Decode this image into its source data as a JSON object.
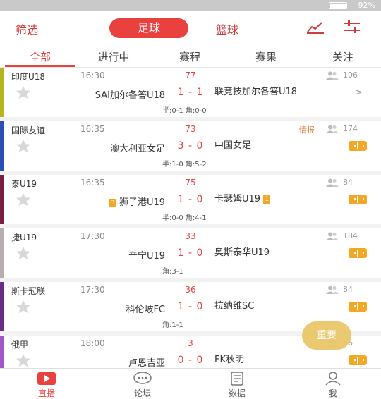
{
  "status_bar": {
    "battery": "92%"
  },
  "header": {
    "filter_label": "筛选",
    "football_label": "足球",
    "basketball_label": "篮球"
  },
  "tabs": [
    {
      "label": "全部",
      "active": true
    },
    {
      "label": "进行中"
    },
    {
      "label": "赛程"
    },
    {
      "label": "赛果"
    },
    {
      "label": "关注"
    }
  ],
  "matches": [
    {
      "league": "印度U18",
      "color": "#b5b51f",
      "time": "16:30",
      "minute": "77",
      "intel": "",
      "fans": "106",
      "home": "SAI加尔各答U18",
      "score": "1 - 1",
      "away": "联竞技加尔各答U18",
      "sub": "半:0-1   角:0-0",
      "action": "chevron"
    },
    {
      "league": "国际友谊",
      "color": "#2b4fb5",
      "time": "16:35",
      "minute": "73",
      "intel": "情报",
      "fans": "174",
      "home": "澳大利亚女足",
      "score": "3 - 0",
      "away": "中国女足",
      "sub": "半:1-0   角:5-2",
      "action": "live"
    },
    {
      "league": "泰U19",
      "color": "#7b1f3e",
      "time": "16:35",
      "minute": "75",
      "intel": "",
      "fans": "84",
      "home_rank": "3",
      "home": "狮子港U19",
      "score": "1 - 0",
      "away": "卡瑟姆U19",
      "away_rank": "1",
      "sub": "半:0-0   角:4-1",
      "action": "live"
    },
    {
      "league": "捷U19",
      "color": "#b8aeb0",
      "time": "17:30",
      "minute": "33",
      "intel": "",
      "fans": "184",
      "home": "辛宁U19",
      "score": "1 - 0",
      "away": "奥斯泰华U19",
      "sub": "角:3-1",
      "action": "live"
    },
    {
      "league": "斯卡冠联",
      "color": "#6a2d86",
      "time": "17:30",
      "minute": "36",
      "intel": "",
      "fans": "84",
      "home": "科伦坡FC",
      "score": "1 - 0",
      "away": "拉纳维SC",
      "sub": "角:1-1",
      "action": "live"
    },
    {
      "league": "俄甲",
      "color": "#a058c8",
      "time": "18:00",
      "minute": "3",
      "intel": "",
      "fans": "56",
      "home": "卢恩吉亚",
      "score": "0 - 0",
      "away": "FK秋明",
      "sub": "",
      "action": "live"
    }
  ],
  "fab_label": "重要",
  "bottom_nav": [
    {
      "label": "直播",
      "icon": "play-icon",
      "active": true
    },
    {
      "label": "论坛",
      "icon": "chat-bubble-icon"
    },
    {
      "label": "数据",
      "icon": "document-icon"
    },
    {
      "label": "我",
      "icon": "person-icon"
    }
  ],
  "colors": {
    "accent": "#e9423e",
    "live_button": "#f5a623",
    "fab": "#e9c76a"
  }
}
